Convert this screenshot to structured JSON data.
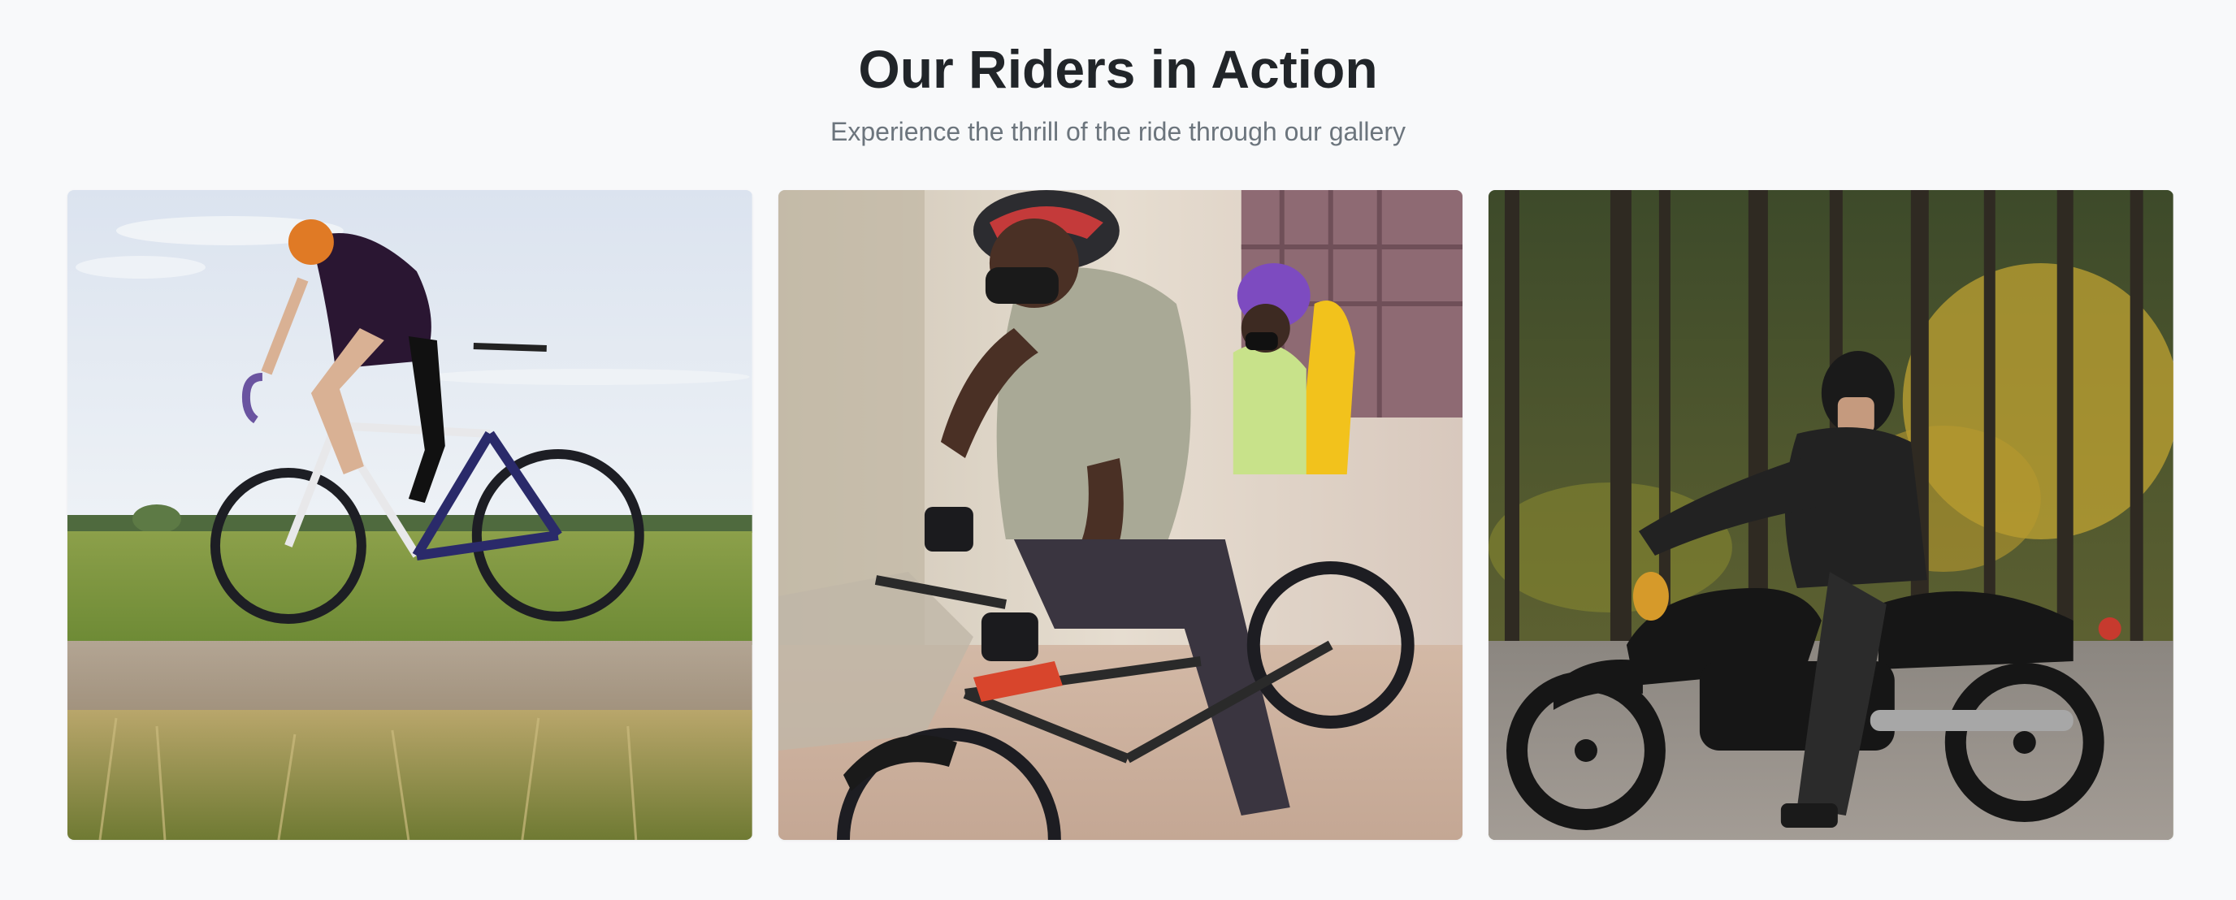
{
  "gallery": {
    "title": "Our Riders in Action",
    "subtitle": "Experience the thrill of the ride through our gallery",
    "photos": [
      {
        "icon": "road-cyclist-photo",
        "scene": "road cyclist"
      },
      {
        "icon": "parent-child-bike-photo",
        "scene": "parent and child on bike"
      },
      {
        "icon": "motorcycle-rider-photo",
        "scene": "motorcycle rider in forest"
      }
    ]
  },
  "colors": {
    "background": "#f8f9fa",
    "title": "#212529",
    "subtitle": "#6c757d"
  }
}
